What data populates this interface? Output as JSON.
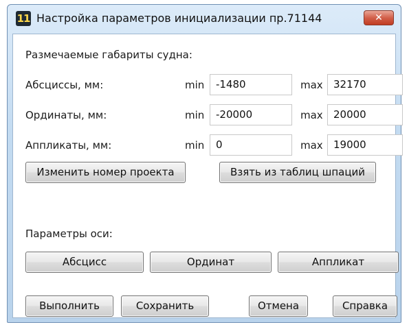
{
  "window": {
    "title": "Настройка параметров инициализации пр.71144",
    "icon_label": "11",
    "close_label": "✕"
  },
  "dimensions": {
    "heading": "Размечаемые габариты судна:",
    "rows": [
      {
        "label": "Абсциссы, мм:",
        "min_label": "min",
        "min": "-1480",
        "max_label": "max",
        "max": "32170"
      },
      {
        "label": "Ординаты, мм:",
        "min_label": "min",
        "min": "-20000",
        "max_label": "max",
        "max": "20000"
      },
      {
        "label": "Аппликаты, мм:",
        "min_label": "min",
        "min": "0",
        "max_label": "max",
        "max": "19000"
      }
    ]
  },
  "actions": {
    "change_project": "Изменить номер проекта",
    "take_from_tables": "Взять из таблиц шпаций"
  },
  "axis": {
    "heading": "Параметры оси:",
    "buttons": [
      "Абсцисс",
      "Ординат",
      "Аппликат"
    ]
  },
  "footer": {
    "run": "Выполнить",
    "save": "Сохранить",
    "cancel": "Отмена",
    "help": "Справка"
  }
}
